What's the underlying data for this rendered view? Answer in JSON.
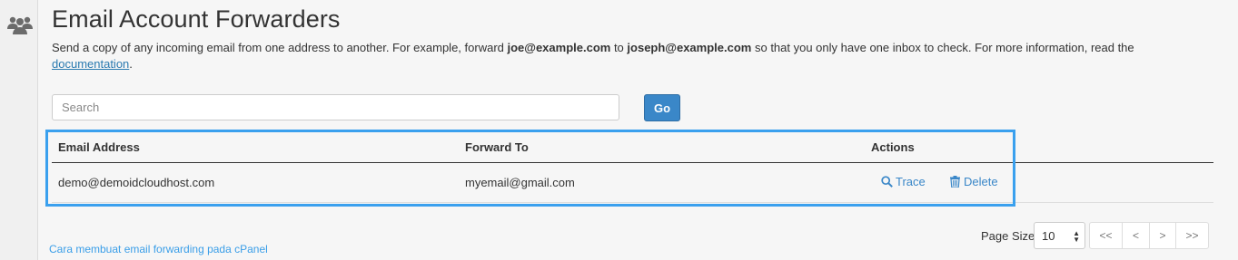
{
  "sidebar": {
    "icon": "users-icon"
  },
  "page": {
    "title": "Email Account Forwarders",
    "description": {
      "part1": "Send a copy of any incoming email from one address to another. For example, forward ",
      "example_from": "joe@example.com",
      "part2": " to ",
      "example_to": "joseph@example.com",
      "part3": " so that you only have one inbox to check. For more information, read the ",
      "doc_link": "documentation",
      "part4": "."
    }
  },
  "search": {
    "placeholder": "Search",
    "value": "",
    "go_label": "Go"
  },
  "table": {
    "headers": {
      "email": "Email Address",
      "forward": "Forward To",
      "actions": "Actions"
    },
    "rows": [
      {
        "email": "demo@demoidcloudhost.com",
        "forward": "myemail@gmail.com",
        "trace": "Trace",
        "delete": "Delete"
      }
    ]
  },
  "footer": {
    "help_link": "Cara membuat email forwarding pada cPanel",
    "page_size_label": "Page Size",
    "page_size": "10",
    "pager": {
      "first": "<<",
      "prev": "<",
      "next": ">",
      "last": ">>"
    }
  },
  "colors": {
    "accent": "#3a87c8",
    "highlight": "#3aa0ee",
    "link": "#2a7ab0"
  }
}
